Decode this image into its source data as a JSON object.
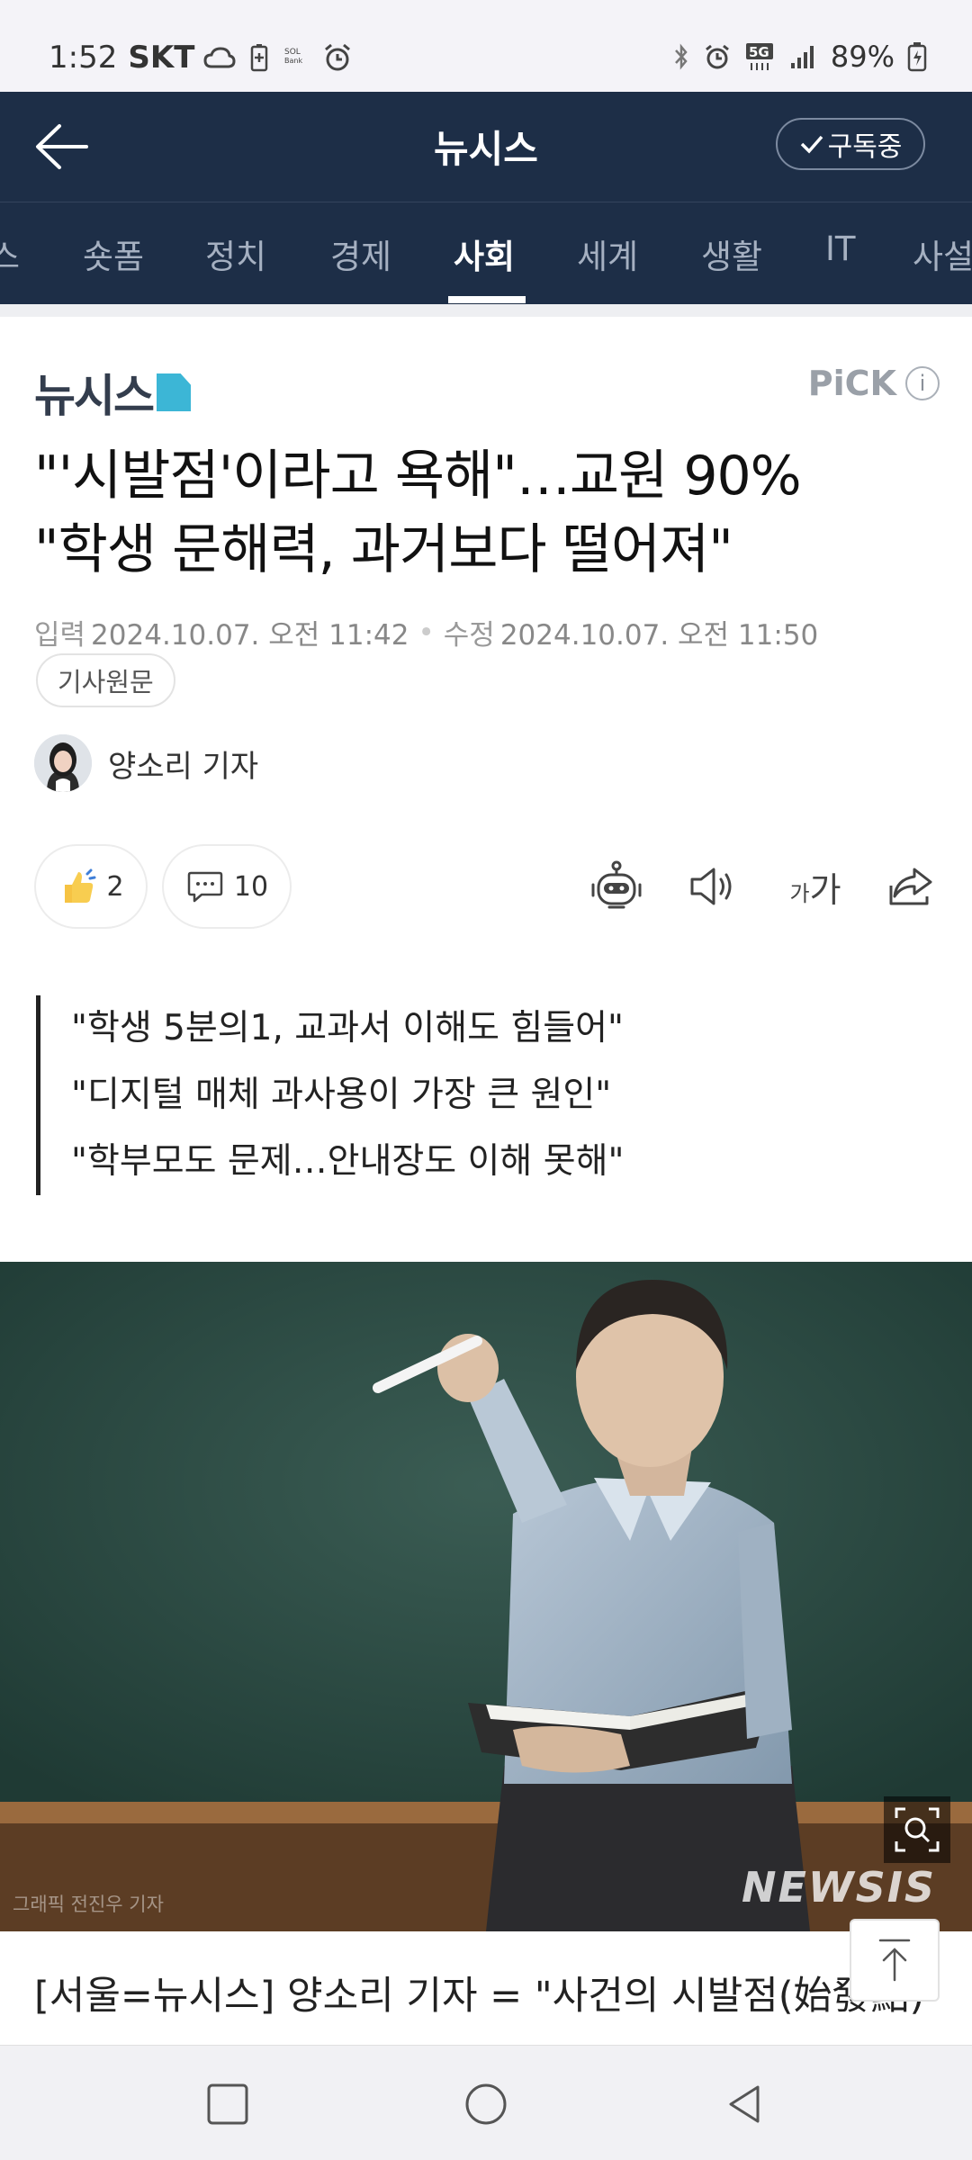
{
  "status_bar": {
    "time": "1:52",
    "carrier": "SKT",
    "battery": "89%",
    "network": "5G"
  },
  "app_bar": {
    "title": "뉴시스",
    "subscribe_label": "구독중"
  },
  "tabs": [
    {
      "label": "스",
      "active": false
    },
    {
      "label": "숏폼",
      "active": false
    },
    {
      "label": "정치",
      "active": false
    },
    {
      "label": "경제",
      "active": false
    },
    {
      "label": "사회",
      "active": true
    },
    {
      "label": "세계",
      "active": false
    },
    {
      "label": "생활",
      "active": false
    },
    {
      "label": "IT",
      "active": false
    },
    {
      "label": "사설",
      "active": false
    }
  ],
  "article": {
    "press_name": "뉴시스",
    "pick_label": "PiCK",
    "pick_info": "i",
    "headline_line1": "\"'시발점'이라고 욕해\"…교원 90%",
    "headline_line2": "\"학생 문해력, 과거보다 떨어져\"",
    "input_label": "입력",
    "input_date": "2024.10.07. 오전 11:42",
    "edit_label": "수정",
    "edit_date": "2024.10.07. 오전 11:50",
    "source_button": "기사원문",
    "reporter": "양소리 기자",
    "like_count": "2",
    "comment_count": "10",
    "font_size_small": "가",
    "font_size_large": "가",
    "quotes": [
      "\"학생 5분의1, 교과서 이해도 힘들어\"",
      "\"디지털 매체 과사용이 가장 큰 원인\"",
      "\"학부모도 문제…안내장도 이해 못해\""
    ],
    "photo_credit": "그래픽 전진우 기자",
    "photo_watermark": "NEWSIS",
    "body_line1": "[서울=뉴시스] 양소리 기자 = \"사건의 시발점(始發點)"
  },
  "colors": {
    "app_bar": "#1d2e47",
    "accent": "#3cb6d6",
    "chalkboard": "#2d4a42"
  }
}
